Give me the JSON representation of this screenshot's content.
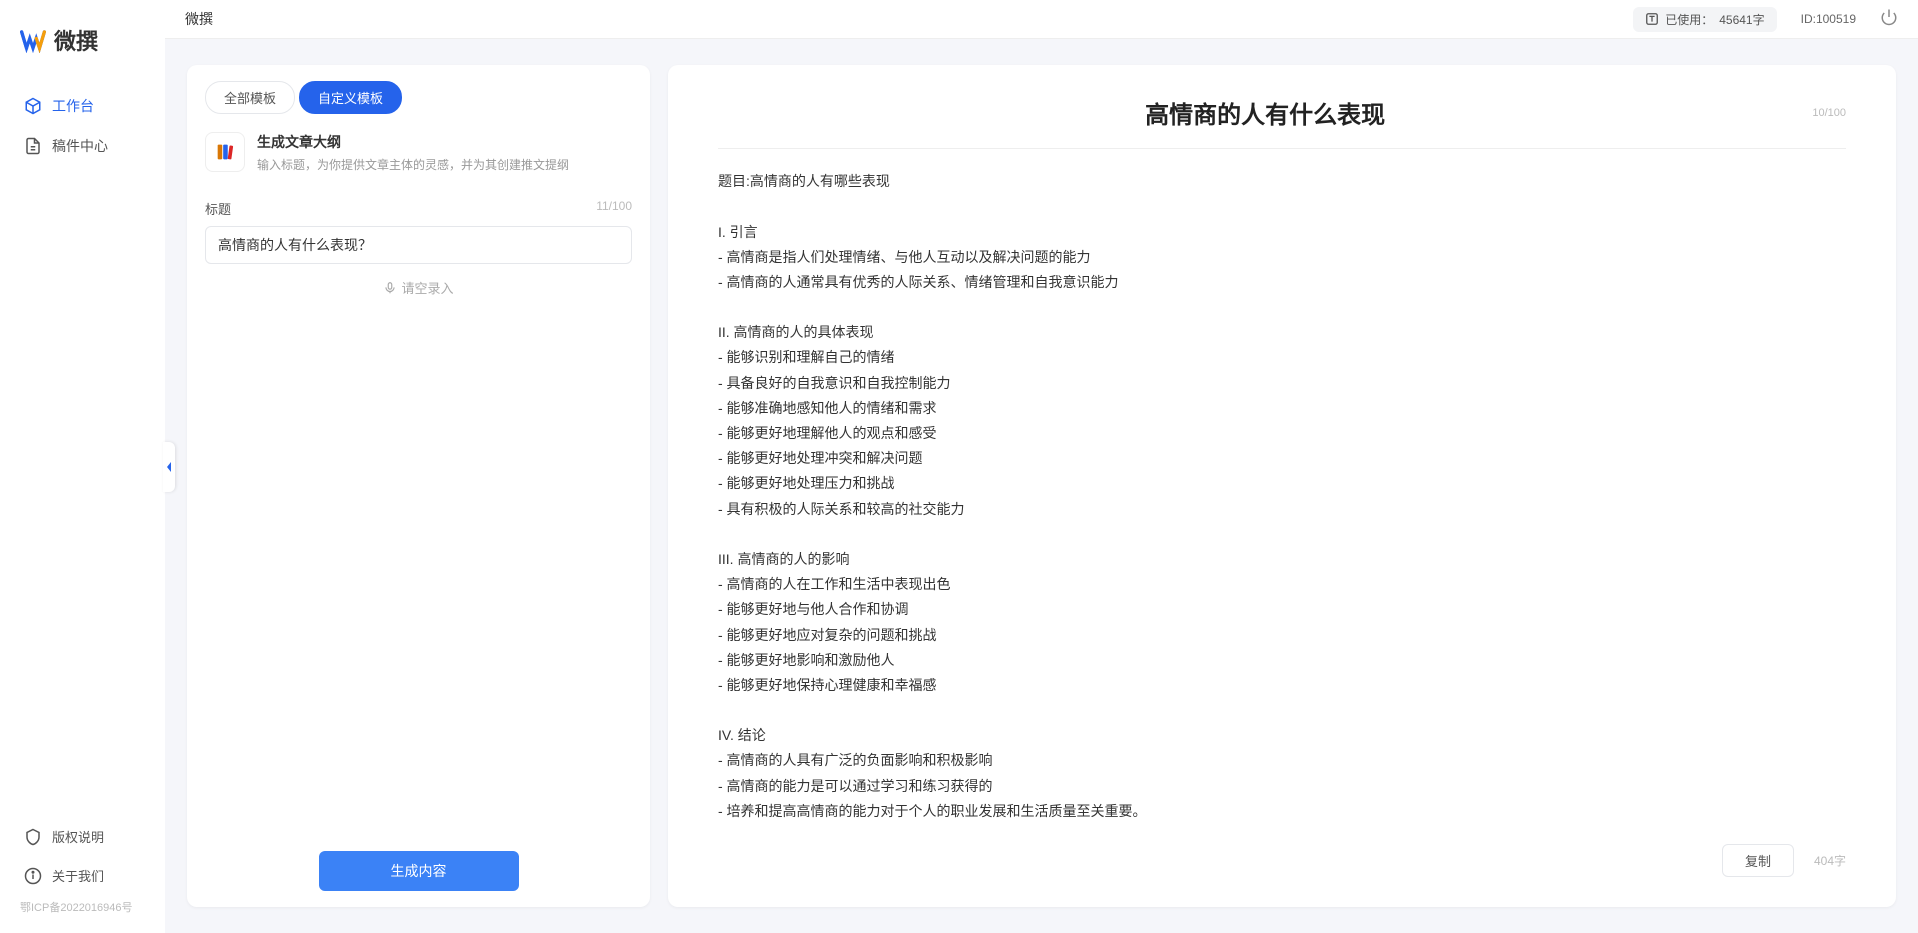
{
  "app": {
    "name": "微撰",
    "logo_text": "微撰"
  },
  "topbar": {
    "title": "微撰",
    "usage_prefix": "已使用：",
    "usage_value": "45641字",
    "user_id": "ID:100519"
  },
  "sidebar": {
    "items": [
      {
        "label": "工作台"
      },
      {
        "label": "稿件中心"
      }
    ],
    "footer": [
      {
        "label": "版权说明"
      },
      {
        "label": "关于我们"
      }
    ],
    "icp": "鄂ICP备2022016946号"
  },
  "left": {
    "tabs": [
      {
        "label": "全部模板"
      },
      {
        "label": "自定义模板"
      }
    ],
    "template": {
      "name": "生成文章大纲",
      "desc": "输入标题，为你提供文章主体的灵感，并为其创建推文提纲"
    },
    "field_label": "标题",
    "field_counter": "11/100",
    "title_value": "高情商的人有什么表现？",
    "voice_label": "请空录入",
    "generate_label": "生成内容"
  },
  "right": {
    "title": "高情商的人有什么表现",
    "title_counter": "10/100",
    "body": "题目:高情商的人有哪些表现\n\nI. 引言\n- 高情商是指人们处理情绪、与他人互动以及解决问题的能力\n- 高情商的人通常具有优秀的人际关系、情绪管理和自我意识能力\n\nII. 高情商的人的具体表现\n- 能够识别和理解自己的情绪\n- 具备良好的自我意识和自我控制能力\n- 能够准确地感知他人的情绪和需求\n- 能够更好地理解他人的观点和感受\n- 能够更好地处理冲突和解决问题\n- 能够更好地处理压力和挑战\n- 具有积极的人际关系和较高的社交能力\n\nIII. 高情商的人的影响\n- 高情商的人在工作和生活中表现出色\n- 能够更好地与他人合作和协调\n- 能够更好地应对复杂的问题和挑战\n- 能够更好地影响和激励他人\n- 能够更好地保持心理健康和幸福感\n\nIV. 结论\n- 高情商的人具有广泛的负面影响和积极影响\n- 高情商的能力是可以通过学习和练习获得的\n- 培养和提高高情商的能力对于个人的职业发展和生活质量至关重要。",
    "copy_label": "复制",
    "word_count": "404字"
  }
}
